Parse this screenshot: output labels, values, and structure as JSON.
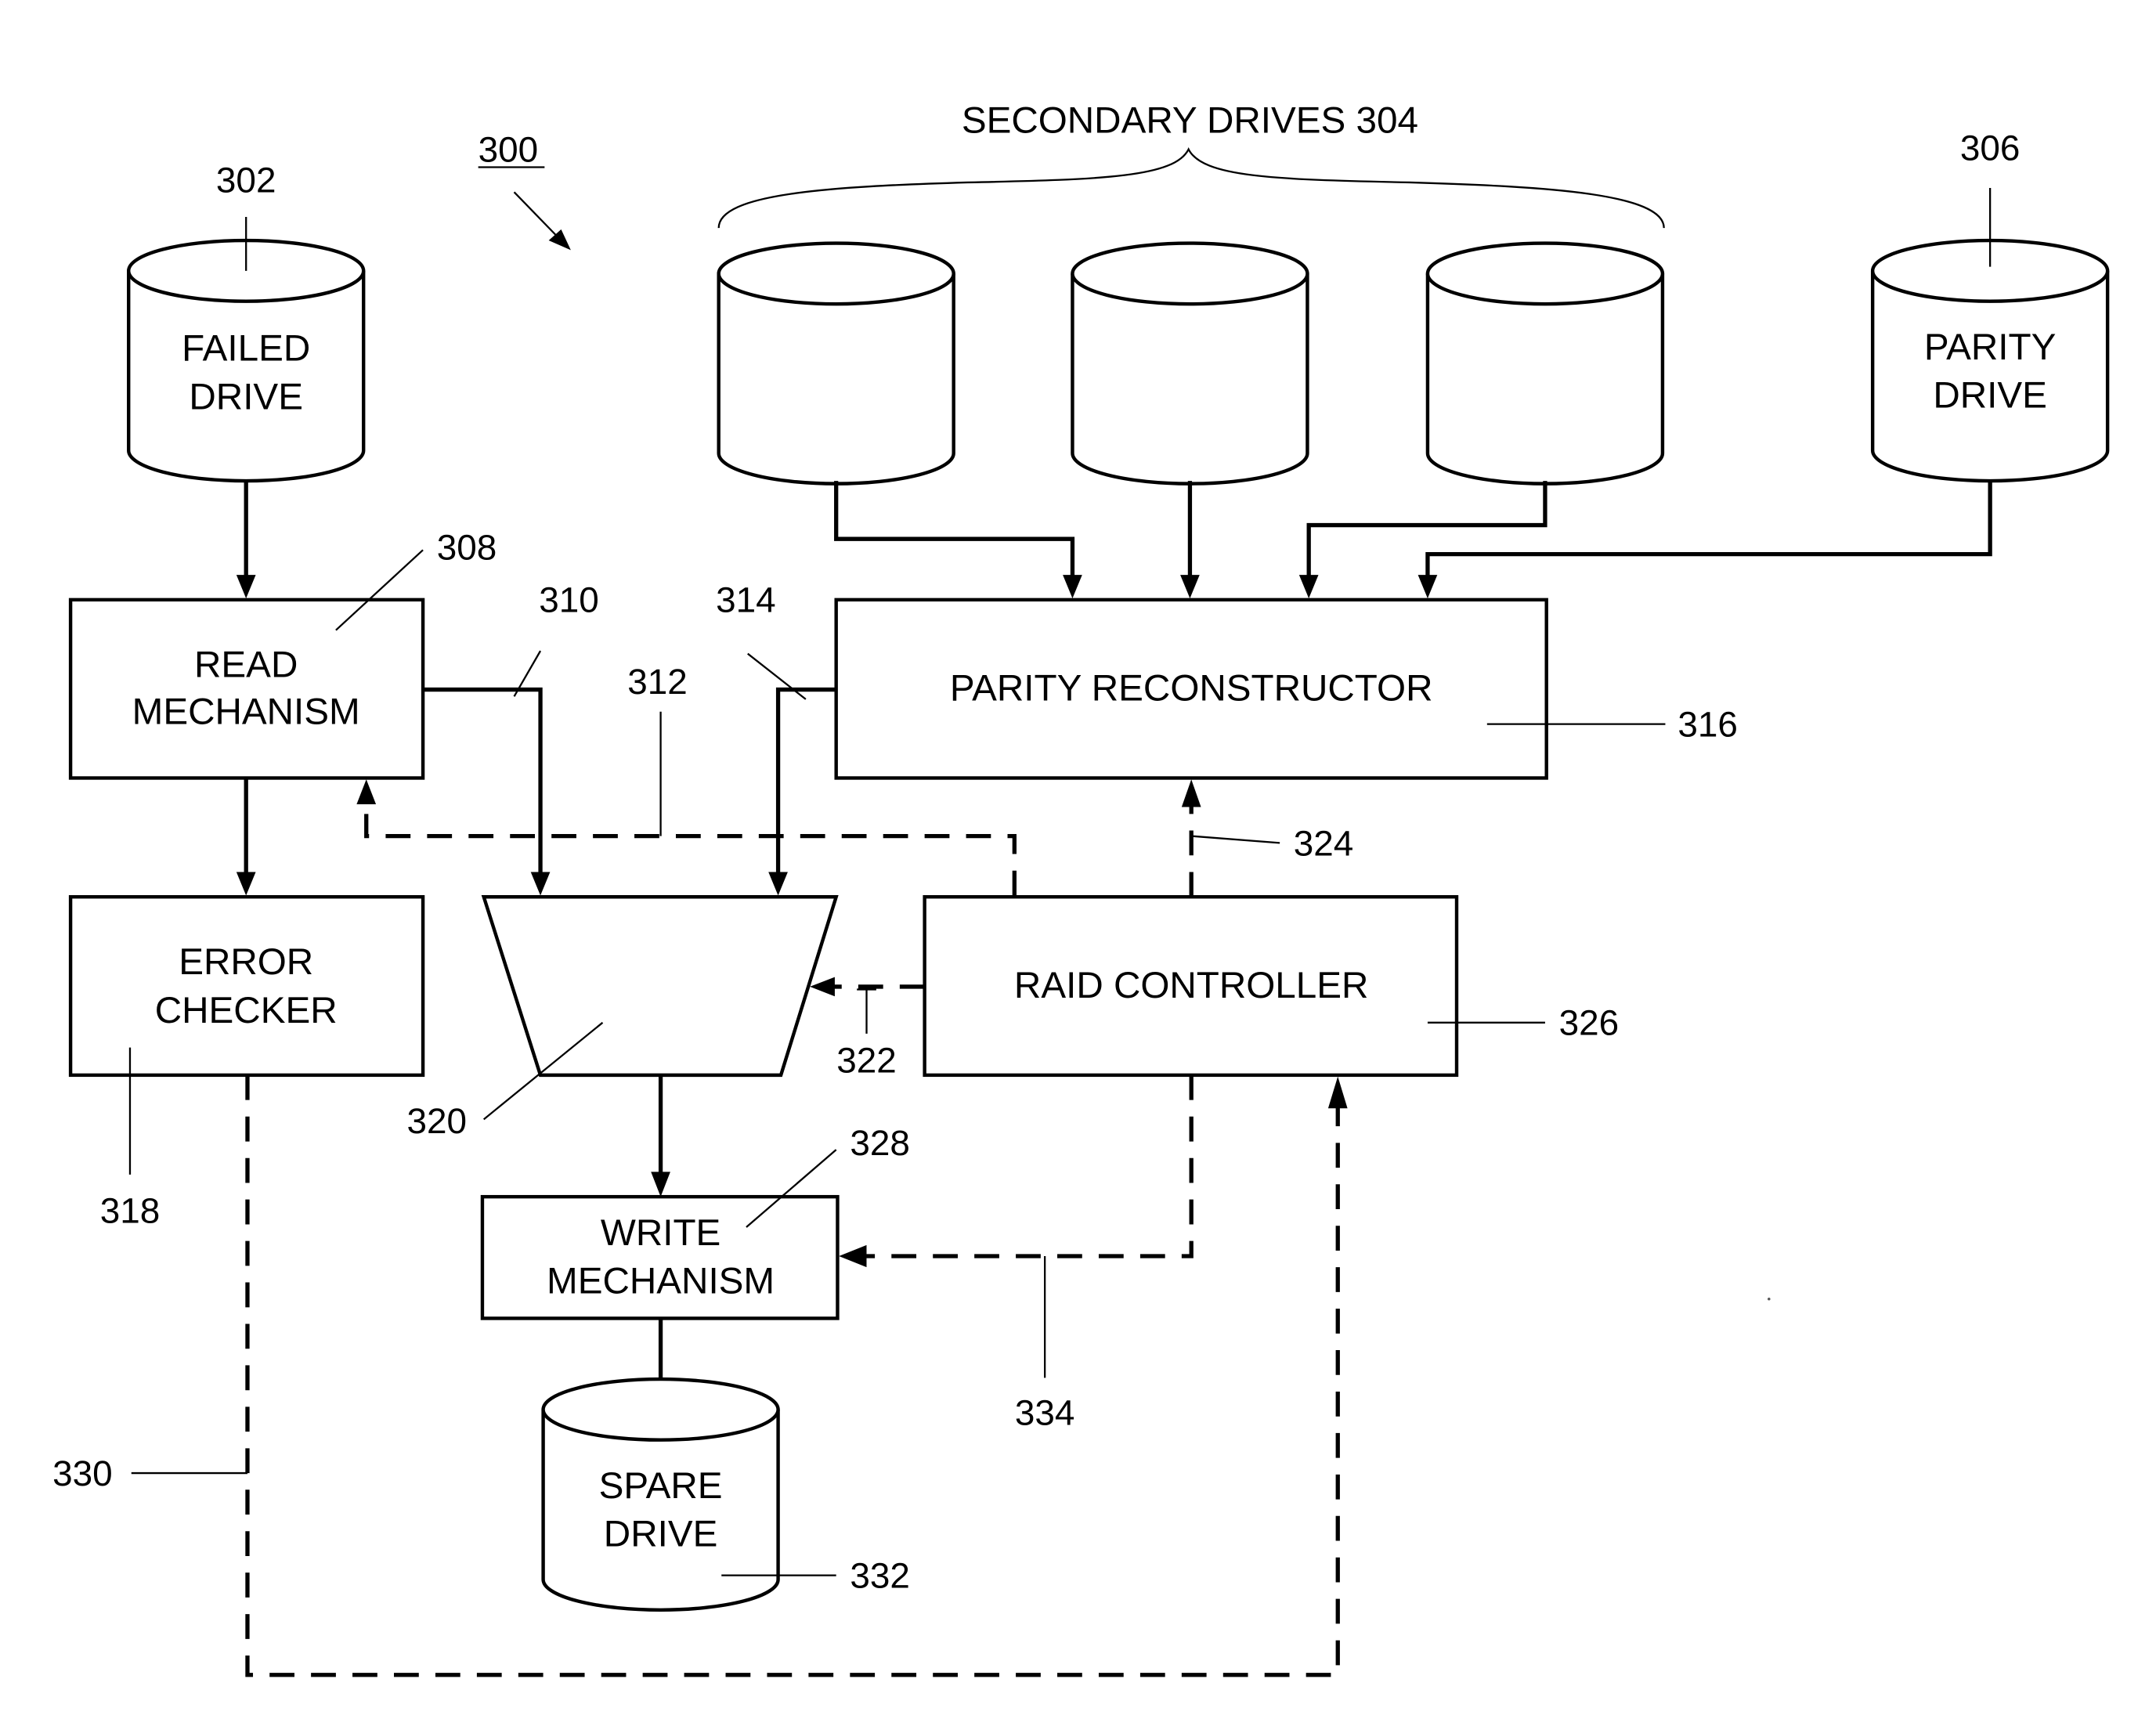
{
  "figure": {
    "ref": "300",
    "bracket_label": "SECONDARY DRIVES 304"
  },
  "nodes": {
    "failed_drive": {
      "ref": "302",
      "lines": [
        "FAILED",
        "DRIVE"
      ]
    },
    "secondary_drives": {
      "count": 3
    },
    "parity_drive": {
      "ref": "306",
      "lines": [
        "PARITY",
        "DRIVE"
      ]
    },
    "read_mechanism": {
      "ref": "308",
      "lines": [
        "READ",
        "MECHANISM"
      ]
    },
    "parity_reconstructor": {
      "ref": "316",
      "lines": [
        "PARITY RECONSTRUCTOR"
      ]
    },
    "error_checker": {
      "ref": "318",
      "lines": [
        "ERROR",
        "CHECKER"
      ]
    },
    "multiplexer": {
      "ref": "320"
    },
    "raid_controller": {
      "ref": "326",
      "lines": [
        "RAID CONTROLLER"
      ]
    },
    "write_mechanism": {
      "ref": "328",
      "lines": [
        "WRITE",
        "MECHANISM"
      ]
    },
    "spare_drive": {
      "ref": "332",
      "lines": [
        "SPARE",
        "DRIVE"
      ]
    }
  },
  "connections": {
    "read_to_mux": {
      "ref": "310",
      "style": "solid"
    },
    "controller_to_read": {
      "ref": "312",
      "style": "dashed"
    },
    "reconstructor_to_mux": {
      "ref": "314",
      "style": "solid"
    },
    "controller_to_mux": {
      "ref": "322",
      "style": "dashed"
    },
    "controller_to_reconstructor": {
      "ref": "324",
      "style": "dashed"
    },
    "checker_to_controller": {
      "ref": "330",
      "style": "dashed"
    },
    "controller_to_write": {
      "ref": "334",
      "style": "dashed"
    }
  }
}
